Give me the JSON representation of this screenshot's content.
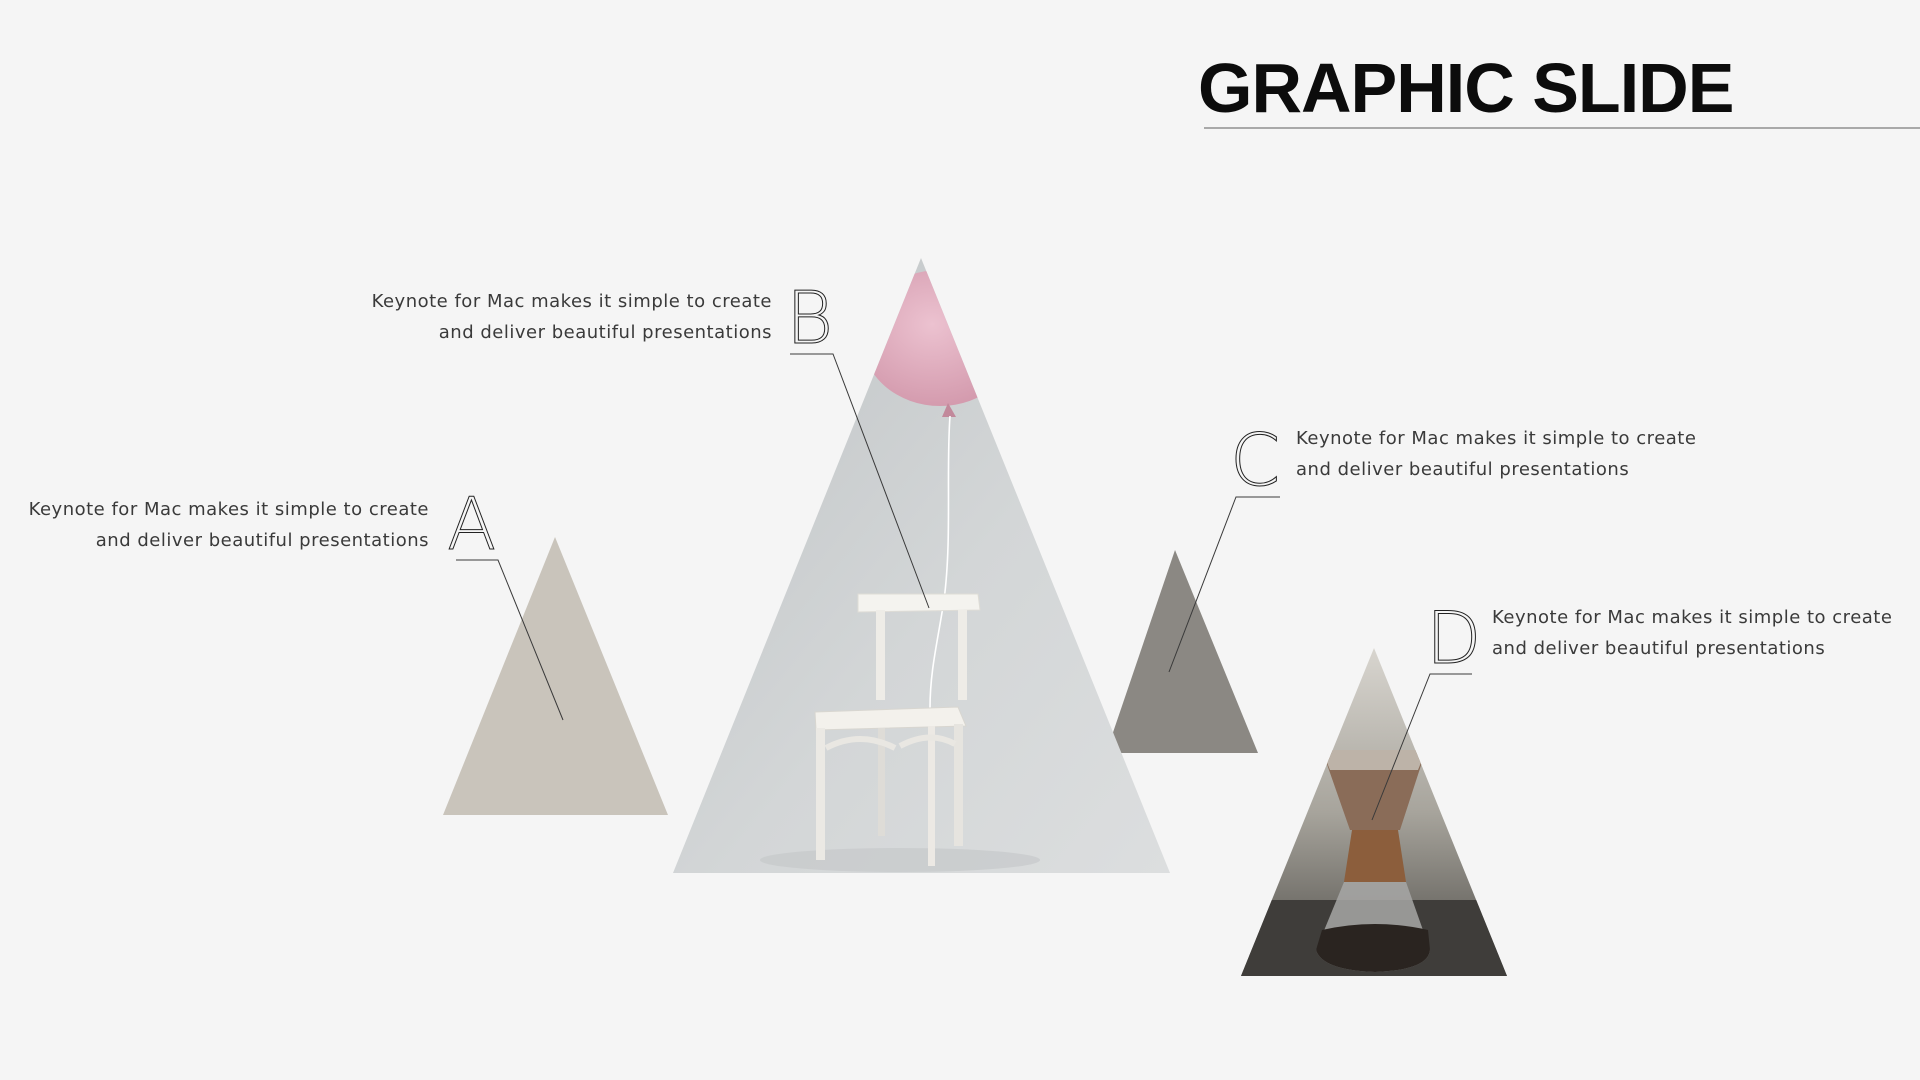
{
  "slide": {
    "title": "GRAPHIC SLIDE",
    "callouts": [
      {
        "letter": "A",
        "line1": "Keynote for Mac makes it simple to create",
        "line2": "and deliver beautiful presentations"
      },
      {
        "letter": "B",
        "line1": "Keynote for Mac makes it simple to create",
        "line2": "and deliver beautiful presentations"
      },
      {
        "letter": "C",
        "line1": "Keynote for Mac makes it simple to create",
        "line2": "and deliver beautiful presentations"
      },
      {
        "letter": "D",
        "line1": "Keynote for Mac makes it simple to create",
        "line2": "and deliver beautiful presentations"
      }
    ]
  },
  "colors": {
    "background": "#f5f5f5",
    "triangle_a": "#c9c4bb",
    "triangle_c": "#8b8883",
    "title": "#0c0c0c",
    "rule": "#a9a9a9"
  }
}
